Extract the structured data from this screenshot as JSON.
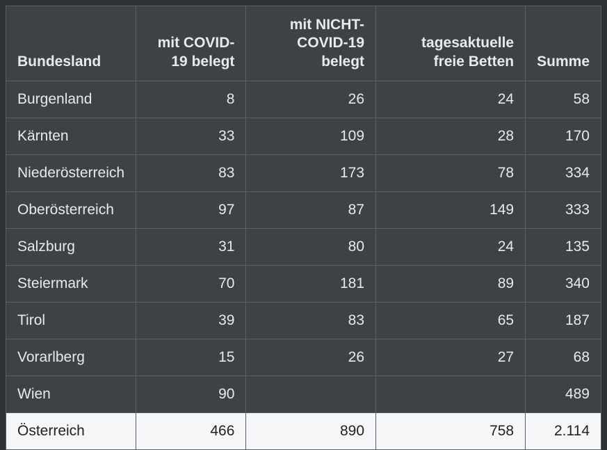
{
  "headers": {
    "col0": "Bundesland",
    "col1": "mit COVID-19 belegt",
    "col2": "mit NICHT-COVID-19 belegt",
    "col3": "tagesaktuelle freie Betten",
    "col4": "Summe"
  },
  "rows": [
    {
      "name": "Burgenland",
      "covid": "8",
      "noncovid": "26",
      "free": "24",
      "sum": "58"
    },
    {
      "name": "Kärnten",
      "covid": "33",
      "noncovid": "109",
      "free": "28",
      "sum": "170"
    },
    {
      "name": "Niederösterreich",
      "covid": "83",
      "noncovid": "173",
      "free": "78",
      "sum": "334"
    },
    {
      "name": "Oberösterreich",
      "covid": "97",
      "noncovid": "87",
      "free": "149",
      "sum": "333"
    },
    {
      "name": "Salzburg",
      "covid": "31",
      "noncovid": "80",
      "free": "24",
      "sum": "135"
    },
    {
      "name": "Steiermark",
      "covid": "70",
      "noncovid": "181",
      "free": "89",
      "sum": "340"
    },
    {
      "name": "Tirol",
      "covid": "39",
      "noncovid": "83",
      "free": "65",
      "sum": "187"
    },
    {
      "name": "Vorarlberg",
      "covid": "15",
      "noncovid": "26",
      "free": "27",
      "sum": "68"
    },
    {
      "name": "Wien",
      "covid": "90",
      "noncovid": "",
      "free": "",
      "sum": "489"
    }
  ],
  "total": {
    "name": "Österreich",
    "covid": "466",
    "noncovid": "890",
    "free": "758",
    "sum": "2.114"
  },
  "chart_data": {
    "type": "table",
    "title": "",
    "columns": [
      "Bundesland",
      "mit COVID-19 belegt",
      "mit NICHT-COVID-19 belegt",
      "tagesaktuelle freie Betten",
      "Summe"
    ],
    "rows": [
      [
        "Burgenland",
        8,
        26,
        24,
        58
      ],
      [
        "Kärnten",
        33,
        109,
        28,
        170
      ],
      [
        "Niederösterreich",
        83,
        173,
        78,
        334
      ],
      [
        "Oberösterreich",
        97,
        87,
        149,
        333
      ],
      [
        "Salzburg",
        31,
        80,
        24,
        135
      ],
      [
        "Steiermark",
        70,
        181,
        89,
        340
      ],
      [
        "Tirol",
        39,
        83,
        65,
        187
      ],
      [
        "Vorarlberg",
        15,
        26,
        27,
        68
      ],
      [
        "Wien",
        90,
        null,
        null,
        489
      ],
      [
        "Österreich",
        466,
        890,
        758,
        2114
      ]
    ]
  }
}
